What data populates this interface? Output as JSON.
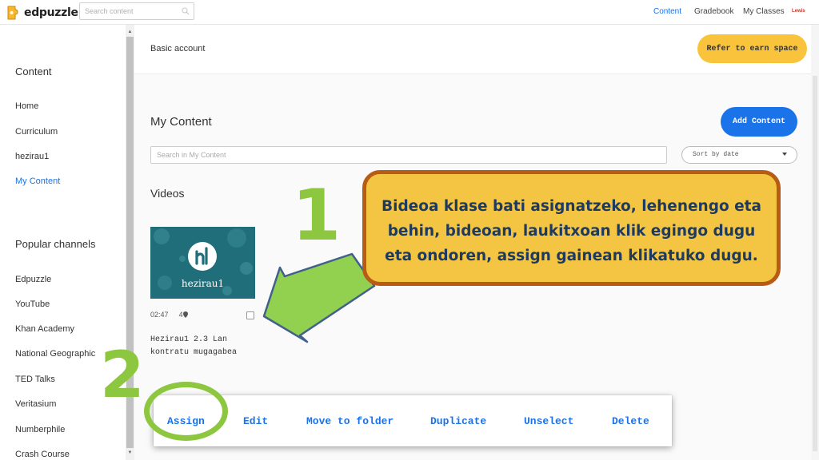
{
  "topbar": {
    "logo_text": "edpuzzle",
    "search_placeholder": "Search content",
    "nav": [
      "Content",
      "Gradebook",
      "My Classes"
    ],
    "active_nav": "Content",
    "user_button": "Lewis"
  },
  "sidebar": {
    "content_heading": "Content",
    "content_items": [
      "Home",
      "Curriculum",
      "hezirau1",
      "My Content"
    ],
    "active_item": "My Content",
    "channels_heading": "Popular channels",
    "channels": [
      "Edpuzzle",
      "YouTube",
      "Khan Academy",
      "National Geographic",
      "TED Talks",
      "Veritasium",
      "Numberphile",
      "Crash Course"
    ]
  },
  "header": {
    "account": "Basic account",
    "refer_button": "Refer to earn space"
  },
  "main": {
    "title": "My Content",
    "add_button": "Add Content",
    "search_placeholder": "Search in My Content",
    "sort_value": "Sort by date",
    "section_label": "Videos",
    "video": {
      "thumbnail_text": "hezirau1",
      "duration": "02:47",
      "question_count": "4",
      "title": "Hezirau1 2.3 Lan kontratu mugagabea"
    }
  },
  "annotation": {
    "step1": "1",
    "step2": "2",
    "callout": "Bideoa klase bati asignatzeko, lehenengo eta behin, bideoan, laukitxoan klik egingo dugu eta ondoren, assign gainean klikatuko  dugu."
  },
  "action_bar": [
    "Assign",
    "Edit",
    "Move to folder",
    "Duplicate",
    "Unselect",
    "Delete"
  ],
  "colors": {
    "accent": "#1a73e8",
    "refer_button": "#f9c43b",
    "callout_fill": "#f4c542",
    "callout_border": "#b85c15",
    "highlight_green": "#8dc63f"
  }
}
